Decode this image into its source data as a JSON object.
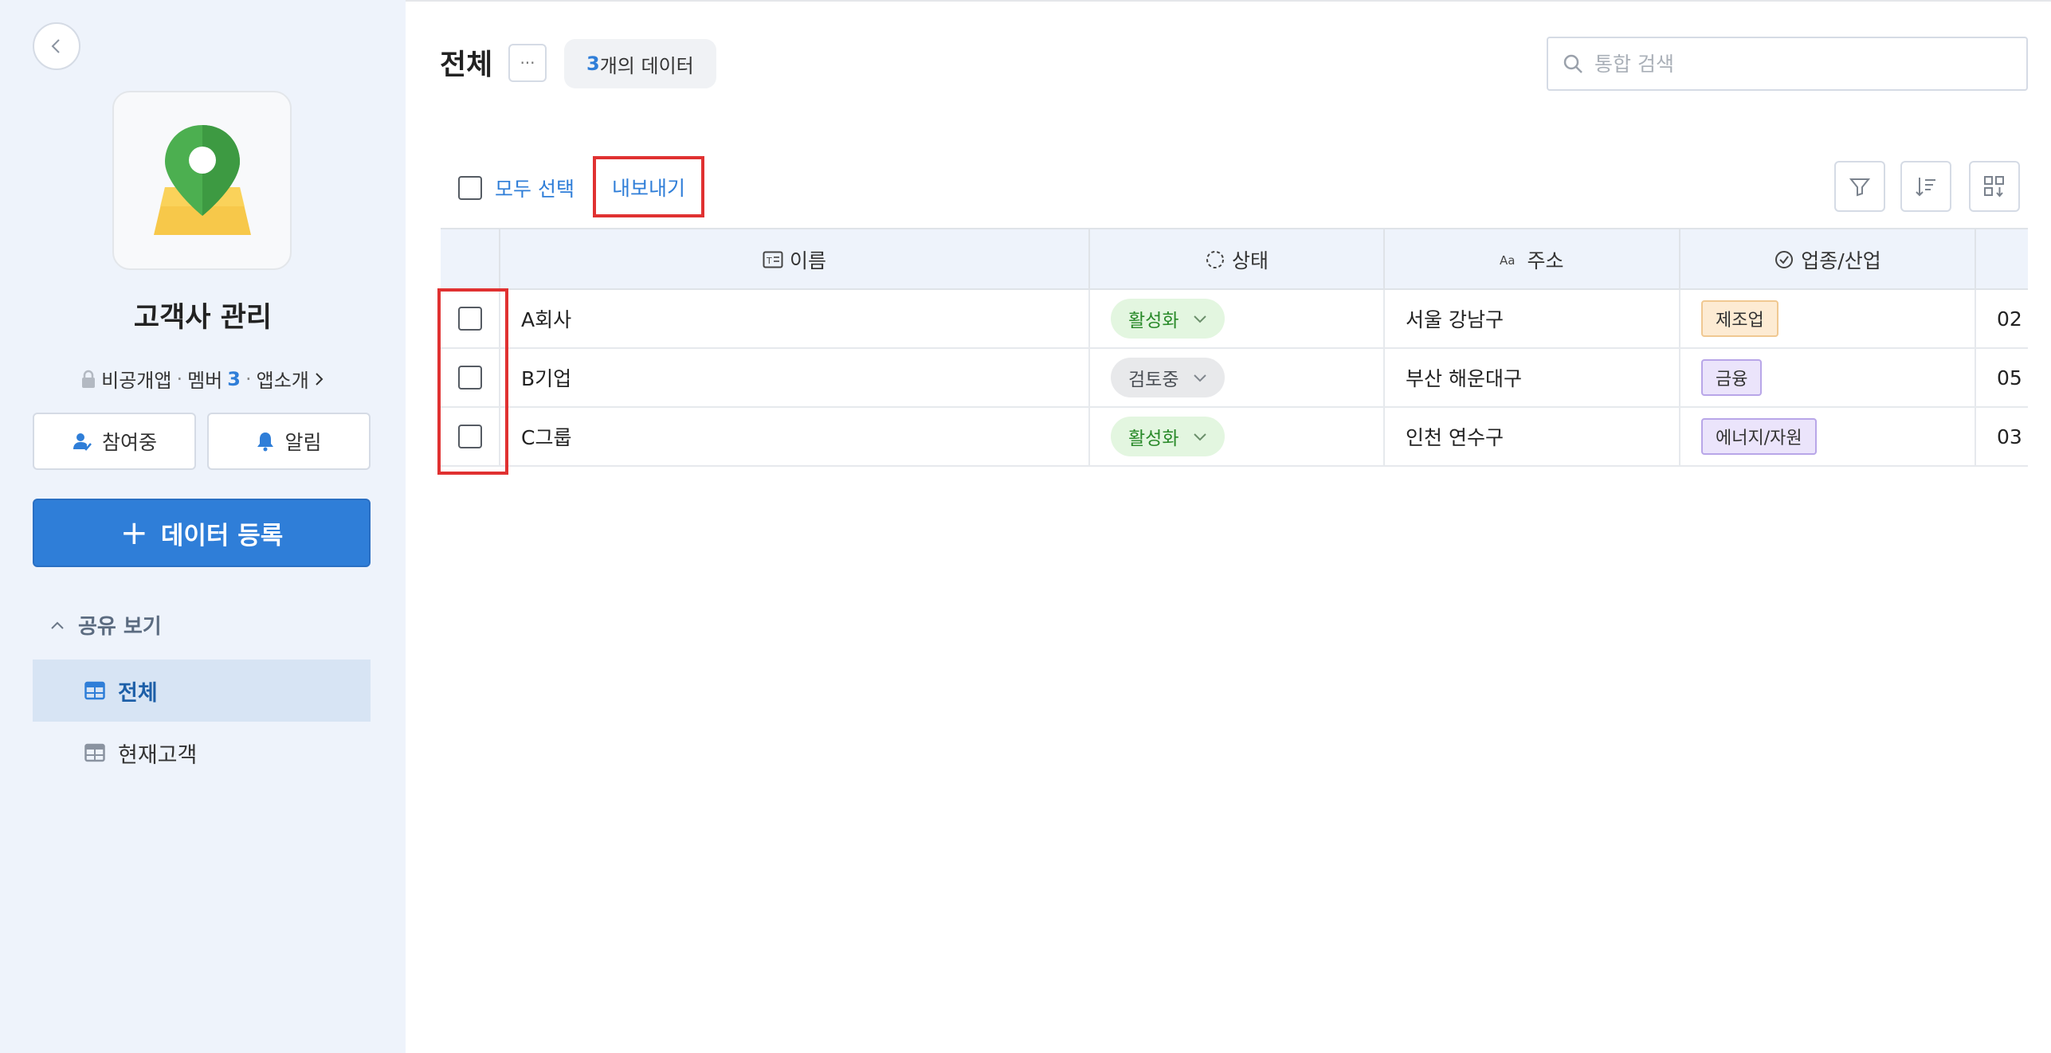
{
  "sidebar": {
    "app_title": "고객사 관리",
    "meta": {
      "visibility": "비공개앱",
      "member_label": "멤버",
      "member_count": "3",
      "intro_label": "앱소개"
    },
    "joined_label": "참여중",
    "alert_label": "알림",
    "register_label": "데이터 등록",
    "section_title": "공유 보기",
    "nav_items": [
      {
        "label": "전체",
        "active": true
      },
      {
        "label": "현재고객",
        "active": false
      }
    ]
  },
  "main": {
    "view_title": "전체",
    "count_value": "3",
    "count_suffix": "개의 데이터",
    "search_placeholder": "통합 검색",
    "select_all_label": "모두 선택",
    "export_label": "내보내기"
  },
  "table": {
    "columns": [
      {
        "key": "name",
        "label": "이름",
        "icon": "text-field-icon"
      },
      {
        "key": "status",
        "label": "상태",
        "icon": "status-circle-icon"
      },
      {
        "key": "address",
        "label": "주소",
        "icon": "text-type-icon"
      },
      {
        "key": "industry",
        "label": "업종/산업",
        "icon": "check-circle-icon"
      }
    ],
    "rows": [
      {
        "name": "A회사",
        "status": "활성화",
        "address": "서울 강남구",
        "industry": "제조업",
        "extra": "02"
      },
      {
        "name": "B기업",
        "status": "검토중",
        "address": "부산 해운대구",
        "industry": "금융",
        "extra": "05"
      },
      {
        "name": "C그룹",
        "status": "활성화",
        "address": "인천 연수구",
        "industry": "에너지/자원",
        "extra": "03"
      }
    ]
  },
  "colors": {
    "accent": "#2f7ed8",
    "highlight": "#e03131",
    "active_status_bg": "#e3f6e0",
    "review_status_bg": "#e8e9eb"
  }
}
